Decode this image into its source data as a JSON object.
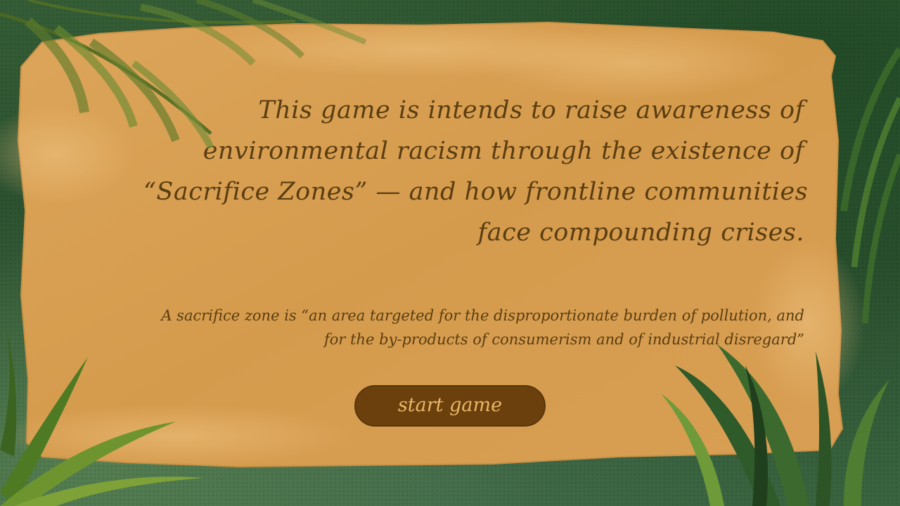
{
  "intro": {
    "headline_lines": [
      "This game is intends to raise awareness of",
      "environmental racism through the existence of",
      "“Sacrifice Zones” — and how frontline communities",
      "face compounding crises."
    ],
    "definition_lines": [
      "A sacrifice zone is “an area targeted for the disproportionate burden of pollution, and",
      "for the by-products of consumerism and of industrial disregard”"
    ]
  },
  "buttons": {
    "start_label": "start game"
  },
  "colors": {
    "panel": "#d89e4f",
    "text": "#5a3d10",
    "button_bg": "#6b400d",
    "button_text": "#e8b766",
    "jungle": "#2c5230"
  }
}
